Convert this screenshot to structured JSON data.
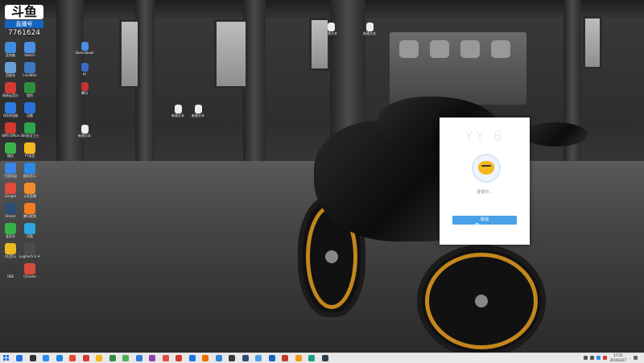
{
  "streamer": {
    "logo": "斗鱼",
    "tag": "直播号",
    "id": "7761624"
  },
  "desktop_icons": [
    {
      "label": "此电脑",
      "color": "#3f8ede"
    },
    {
      "label": "Sketch",
      "color": "#4a8ee6"
    },
    {
      "label": "回收站",
      "color": "#6aa0d8"
    },
    {
      "label": "LiveWire",
      "color": "#3f76c4"
    },
    {
      "label": "网易云音乐",
      "color": "#d33a31"
    },
    {
      "label": "猎豹",
      "color": "#2d8f3e"
    },
    {
      "label": "QQ浏览器",
      "color": "#2f7be2"
    },
    {
      "label": "迅雷",
      "color": "#2a6fd6"
    },
    {
      "label": "WPS Office",
      "color": "#d13a2a"
    },
    {
      "label": "360安全卫士",
      "color": "#2ea44f"
    },
    {
      "label": "微信",
      "color": "#3cb34a"
    },
    {
      "label": "YY语音",
      "color": "#f2b81c"
    },
    {
      "label": "百度网盘",
      "color": "#3b86e5"
    },
    {
      "label": "酷狗音乐",
      "color": "#2b8be5"
    },
    {
      "label": "Google",
      "color": "#e24a3b"
    },
    {
      "label": "斗鱼直播",
      "color": "#f28c28"
    },
    {
      "label": "Steam",
      "color": "#2e4b75"
    },
    {
      "label": "腾讯视频",
      "color": "#f47a20"
    },
    {
      "label": "爱奇艺",
      "color": "#35b34a"
    },
    {
      "label": "优酷",
      "color": "#2aa7e0"
    },
    {
      "label": "QQ音乐",
      "color": "#e8b923"
    },
    {
      "label": "Logitech G HUB",
      "color": "#4b4b4b"
    },
    {
      "label": "OBS",
      "color": "#3a3a3a"
    },
    {
      "label": "Chrome",
      "color": "#d64a3b"
    }
  ],
  "mid_desktop_icons": [
    {
      "label": "Sketchbook",
      "color": "#4a8ee6"
    },
    {
      "label": "ps",
      "color": "#3b6cc4"
    },
    {
      "label": "腾讯",
      "color": "#c23232"
    },
    {
      "label": "新建文本",
      "color": "#ededed"
    },
    {
      "label": "新建文本",
      "color": "#ededed"
    },
    {
      "label": "新建文本",
      "color": "#ededed"
    },
    {
      "label": "新建文本",
      "color": "#ededed"
    },
    {
      "label": "新建文本",
      "color": "#ededed"
    }
  ],
  "login": {
    "title": "YY 8",
    "status": "登录中...",
    "button_label": "取消"
  },
  "taskbar": {
    "icons": [
      "#1a73e8",
      "#333",
      "#2a8cf0",
      "#1e88e5",
      "#e04a2f",
      "#d33a31",
      "#f2b81c",
      "#2d8f3e",
      "#4caf50",
      "#2f7be2",
      "#8e44ad",
      "#e24a3b",
      "#d13a2a",
      "#1a73e8",
      "#ef6c00",
      "#2e86de",
      "#3a3a3a",
      "#2e4b75",
      "#4aa1e8",
      "#1565c0",
      "#c0392b",
      "#f39c12",
      "#16a085",
      "#2c3e50"
    ],
    "time": "17:25",
    "date": "2019/3/27"
  },
  "colors": {
    "accent": "#4aa1e8",
    "taskbar": "#eae8e8"
  }
}
